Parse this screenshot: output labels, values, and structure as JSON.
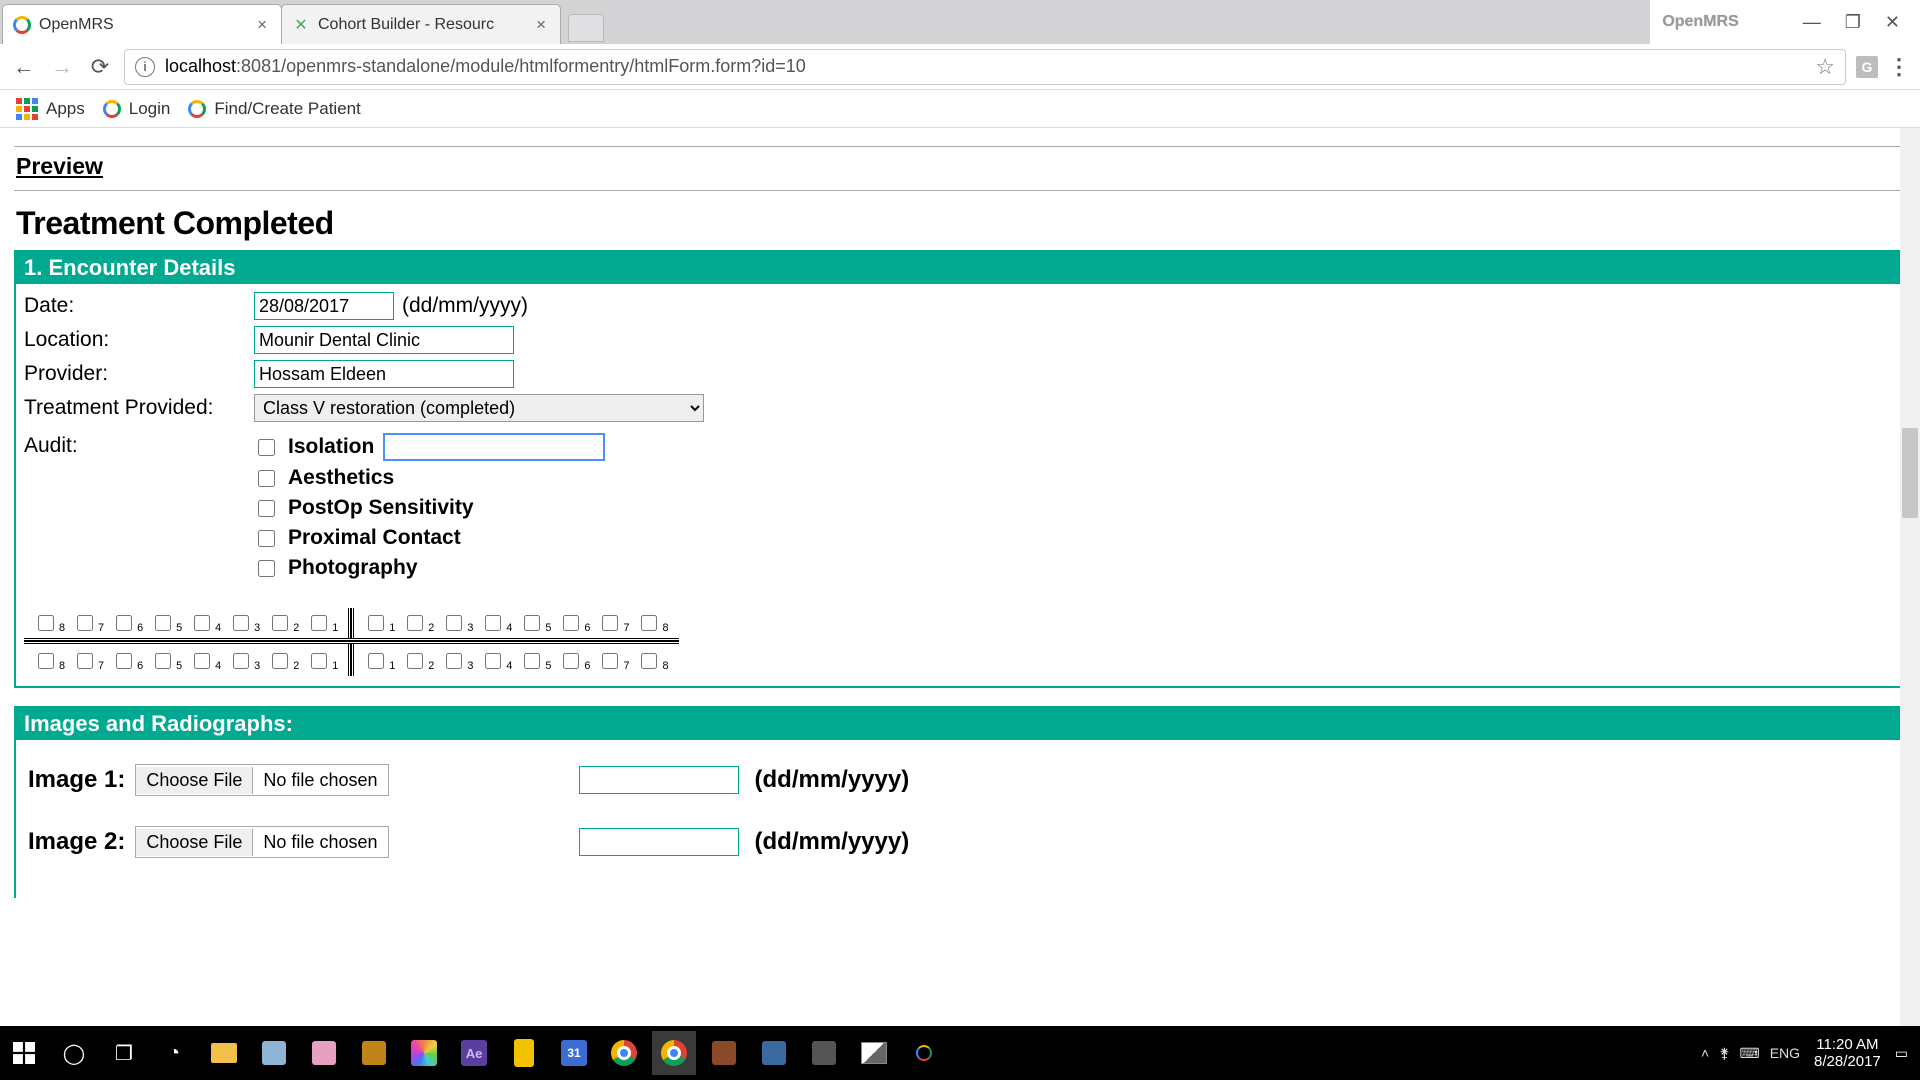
{
  "browser": {
    "tabs": [
      {
        "title": "OpenMRS",
        "active": true
      },
      {
        "title": "Cohort Builder - Resourc",
        "active": false
      }
    ],
    "win_logo": "OpenMRS",
    "url_host": "localhost",
    "url_rest": ":8081/openmrs-standalone/module/htmlformentry/htmlForm.form?id=10",
    "bookmarks": {
      "apps": "Apps",
      "login": "Login",
      "find": "Find/Create Patient"
    }
  },
  "page": {
    "preview": "Preview",
    "title": "Treatment Completed",
    "section1": {
      "header": "1. Encounter Details",
      "date_label": "Date:",
      "date_value": "28/08/2017",
      "date_hint": "(dd/mm/yyyy)",
      "location_label": "Location:",
      "location_value": "Mounir Dental Clinic",
      "provider_label": "Provider:",
      "provider_value": "Hossam Eldeen",
      "treatment_label": "Treatment Provided:",
      "treatment_value": "Class V restoration (completed)",
      "audit_label": "Audit:",
      "audit_items": {
        "isolation": "Isolation",
        "aesthetics": "Aesthetics",
        "postop": "PostOp Sensitivity",
        "proximal": "Proximal Contact",
        "photography": "Photography"
      },
      "teeth_left": [
        "8",
        "7",
        "6",
        "5",
        "4",
        "3",
        "2",
        "1"
      ],
      "teeth_right": [
        "1",
        "2",
        "3",
        "4",
        "5",
        "6",
        "7",
        "8"
      ]
    },
    "section2": {
      "header": "Images and Radiographs:",
      "img1_label": "Image 1:",
      "img2_label": "Image 2:",
      "choose": "Choose File",
      "nofile": "No file chosen",
      "date_hint": "(dd/mm/yyyy)"
    }
  },
  "taskbar": {
    "lang": "ENG",
    "time": "11:20 AM",
    "date": "8/28/2017",
    "cal_day": "31"
  }
}
